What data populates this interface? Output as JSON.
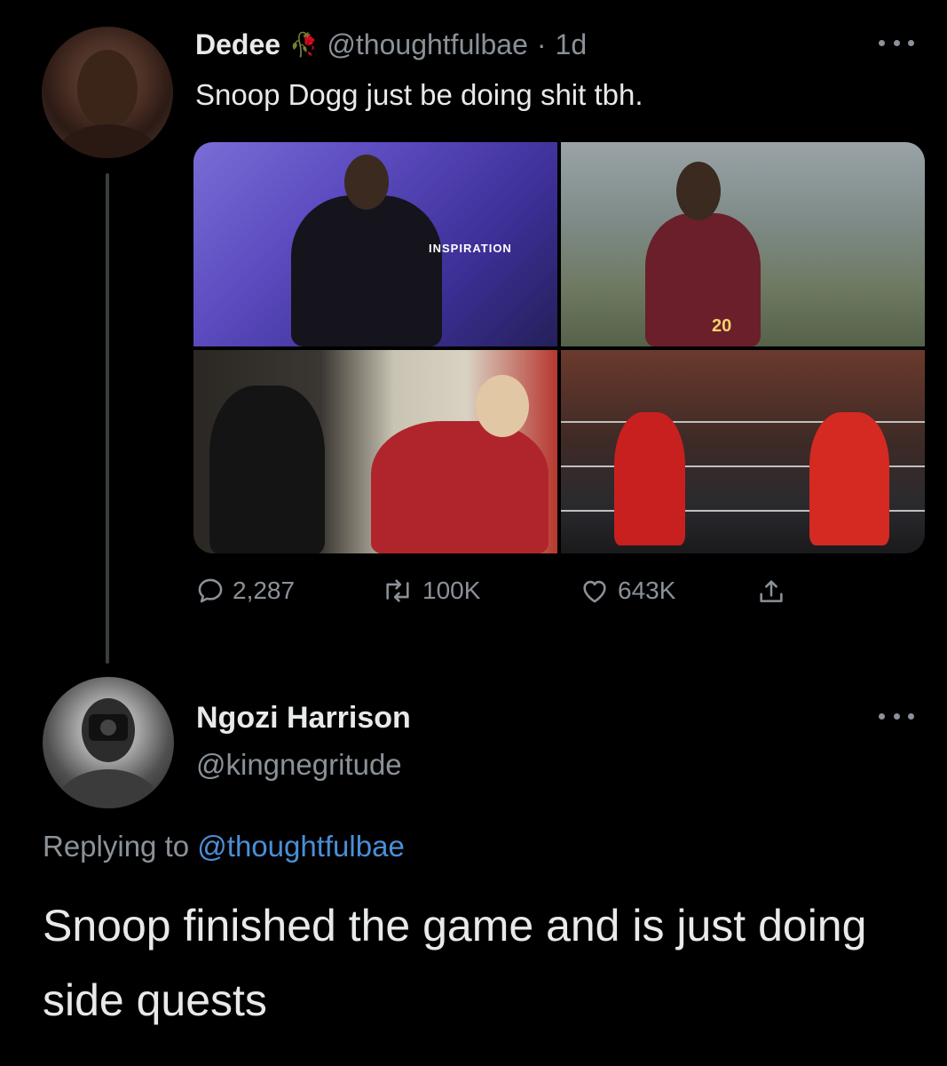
{
  "tweet": {
    "author_name": "Dedee",
    "author_emoji": "🥀",
    "handle": "@thoughtfulbae",
    "separator": "·",
    "time": "1d",
    "text": "Snoop Dogg just be doing shit tbh.",
    "more_icon": "more-horizontal-icon",
    "stats": {
      "replies": "2,287",
      "retweets": "100K",
      "likes": "643K"
    },
    "icons": {
      "reply": "reply-icon",
      "retweet": "retweet-icon",
      "like": "heart-icon",
      "share": "share-icon"
    },
    "media": [
      {
        "name": "snoop-gospel-robe-photo",
        "caption_text": "INSPIRATION"
      },
      {
        "name": "snoop-football-jersey-photo",
        "jersey_number": "20"
      },
      {
        "name": "snoop-martha-stewart-photo"
      },
      {
        "name": "snoop-hulk-hogan-wrestling-photo"
      }
    ]
  },
  "reply": {
    "author_name": "Ngozi Harrison",
    "handle": "@kingnegritude",
    "replying_prefix": "Replying to",
    "replying_mention": "@thoughtfulbae",
    "text": "Snoop finished the game and is just doing side quests"
  },
  "colors": {
    "background": "#000000",
    "primary_text": "#e7e9ea",
    "secondary_text": "#8b9198",
    "mention": "#4a8fd8"
  }
}
